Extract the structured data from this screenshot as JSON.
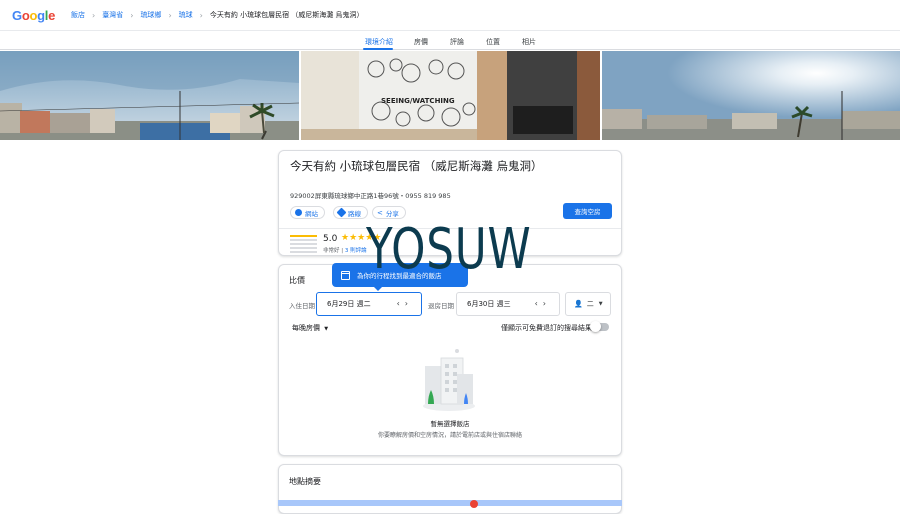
{
  "logo": {
    "text": "Google",
    "letters": [
      {
        "ch": "G",
        "color": "#4285F4"
      },
      {
        "ch": "o",
        "color": "#EA4335"
      },
      {
        "ch": "o",
        "color": "#FBBC05"
      },
      {
        "ch": "g",
        "color": "#4285F4"
      },
      {
        "ch": "l",
        "color": "#34A853"
      },
      {
        "ch": "e",
        "color": "#EA4335"
      }
    ]
  },
  "breadcrumbs": [
    "飯店",
    "臺灣省",
    "琉球鄉",
    "琉球",
    "今天有約 小琉球包層民宿 （威尼斯海灘 烏鬼洞）"
  ],
  "tabs": [
    {
      "label": "環境介紹",
      "active": true
    },
    {
      "label": "房價",
      "active": false
    },
    {
      "label": "評論",
      "active": false
    },
    {
      "label": "位置",
      "active": false
    },
    {
      "label": "相片",
      "active": false
    }
  ],
  "photos": {
    "middle_sign": "SEEING/WATCHING"
  },
  "hotel": {
    "title": "今天有約 小琉球包層民宿 （威尼斯海灘 烏鬼洞）",
    "address": "929002屏東縣琉球鄉中正路1巷96號・0955 819 985",
    "actions": {
      "website": "網站",
      "directions": "路線",
      "share": "分享"
    },
    "check_availability": "查詢空房",
    "rating": {
      "score": "5.0",
      "stars": "★★★★★",
      "label": "非常好",
      "reviews": "3 則評論"
    }
  },
  "compare": {
    "title": "比價",
    "tooltip": "為你的行程找到最適合的飯店",
    "checkin_label": "入住日期",
    "checkin_value": "6月29日 週二",
    "checkout_label": "退房日期",
    "checkout_value": "6月30日 週三",
    "guests_value": "二",
    "price_sort": "每晚房價",
    "free_cancel_label": "僅顯示可免費退訂的搜尋結果",
    "empty_title": "暫無選擇飯店",
    "empty_subtitle": "你要瞭解房價和空房情況，請於電前店或與住宿店聯絡"
  },
  "location": {
    "title": "地點摘要"
  },
  "watermark": "YOSUW",
  "colors": {
    "accent": "#1a73e8",
    "star": "#fbbc04"
  }
}
